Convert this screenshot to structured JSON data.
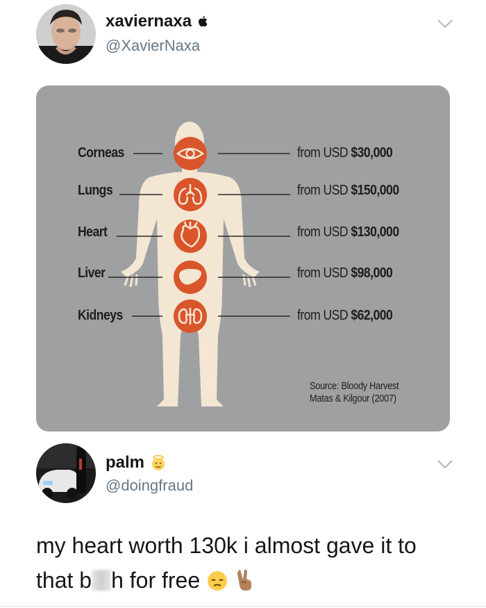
{
  "tweet": {
    "author": {
      "display_name": "xaviernaxa",
      "badge_icon": "apple-logo-icon",
      "handle": "@XavierNaxa"
    },
    "menu_icon": "chevron-down-icon"
  },
  "infographic": {
    "organs": [
      {
        "name": "Corneas",
        "icon": "eye-icon",
        "price_prefix": "from USD",
        "price": "$30,000"
      },
      {
        "name": "Lungs",
        "icon": "lungs-icon",
        "price_prefix": "from USD",
        "price": "$150,000"
      },
      {
        "name": "Heart",
        "icon": "heart-organ-icon",
        "price_prefix": "from USD",
        "price": "$130,000"
      },
      {
        "name": "Liver",
        "icon": "liver-icon",
        "price_prefix": "from USD",
        "price": "$98,000"
      },
      {
        "name": "Kidneys",
        "icon": "kidneys-icon",
        "price_prefix": "from USD",
        "price": "$62,000"
      }
    ],
    "source_line1": "Source: Bloody Harvest",
    "source_line2": "Matas & Kilgour (2007)",
    "colors": {
      "background": "#9fa0a2",
      "body": "#f3e6d3",
      "accent": "#d9552b"
    }
  },
  "reply": {
    "author": {
      "display_name": "palm",
      "badge_icon": "angel-emoji-icon",
      "handle": "@doingfraud"
    },
    "text_part1": "my heart worth 130k i almost gave it to",
    "text_part2_start": "that b",
    "text_part2_end": "h for free",
    "emojis": [
      "pensive-face-emoji",
      "victory-hand-emoji"
    ]
  }
}
